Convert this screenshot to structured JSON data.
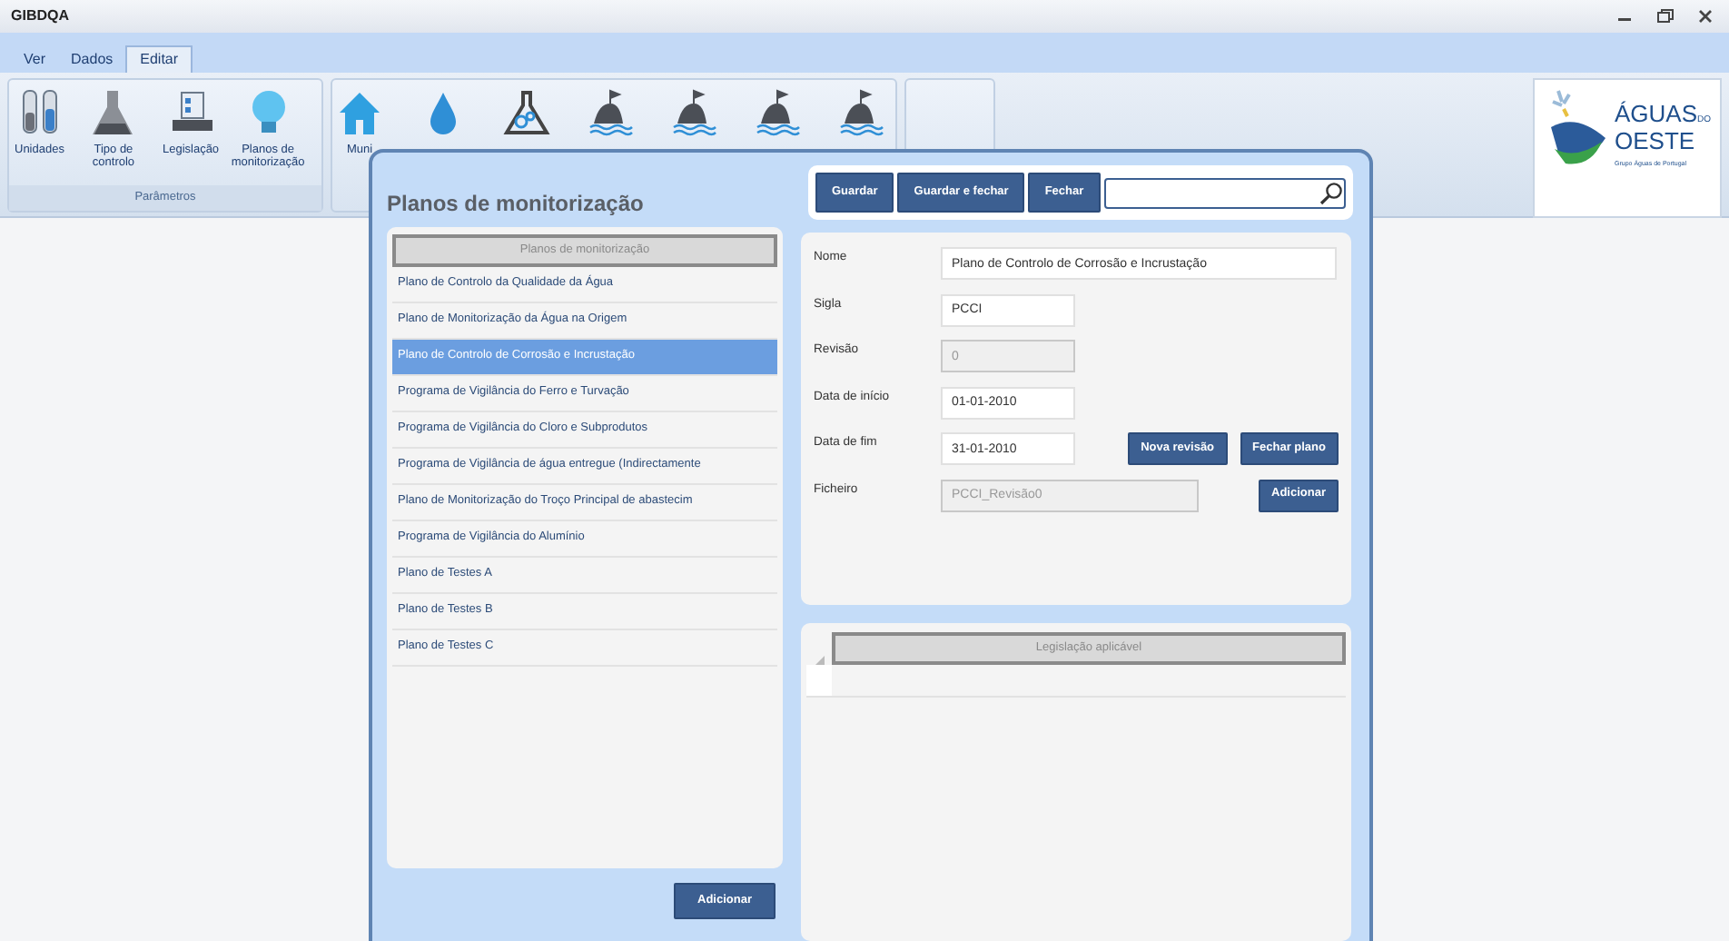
{
  "window": {
    "title": "GIBDQA"
  },
  "menu_tabs": [
    {
      "label": "Ver",
      "selected": false
    },
    {
      "label": "Dados",
      "selected": false
    },
    {
      "label": "Editar",
      "selected": true
    }
  ],
  "ribbon": {
    "groups": [
      {
        "label": "Parâmetros",
        "items": [
          {
            "kind": "test-tubes",
            "label": "Unidades"
          },
          {
            "kind": "flask",
            "label": "Tipo de controlo"
          },
          {
            "kind": "document",
            "label": "Legislação"
          },
          {
            "kind": "lightbulb",
            "label": "Planos de monitorização"
          }
        ]
      },
      {
        "items": [
          {
            "kind": "house",
            "label": "Muni"
          },
          {
            "kind": "drop"
          },
          {
            "kind": "bubble-flask"
          },
          {
            "kind": "island"
          },
          {
            "kind": "island"
          },
          {
            "kind": "island"
          },
          {
            "kind": "island"
          }
        ]
      }
    ]
  },
  "logo": {
    "name": "ÁGUAS",
    "suffix": "DO",
    "name2": "OESTE",
    "tagline": "Grupo Águas de Portugal"
  },
  "dialog": {
    "title": "Planos de monitorização",
    "toolbar_buttons": [
      "Guardar",
      "Guardar e fechar",
      "Fechar"
    ],
    "plans": {
      "header": "Planos de monitorização",
      "add_button": "Adicionar",
      "items": [
        {
          "label": "Plano de Controlo da Qualidade da Água",
          "selected": false
        },
        {
          "label": "Plano de Monitorização da Água na Origem",
          "selected": false
        },
        {
          "label": "Plano de Controlo de Corrosão e Incrustação",
          "selected": true
        },
        {
          "label": "Programa de Vigilância do Ferro e Turvação",
          "selected": false
        },
        {
          "label": "Programa de Vigilância do Cloro e Subprodutos",
          "selected": false
        },
        {
          "label": "Programa de Vigilância de água entregue (Indirectamente",
          "selected": false
        },
        {
          "label": "Plano de Monitorização do Troço Principal de abastecim",
          "selected": false
        },
        {
          "label": "Programa de Vigilância do Alumínio",
          "selected": false
        },
        {
          "label": "Plano de Testes A",
          "selected": false
        },
        {
          "label": "Plano de Testes B",
          "selected": false
        },
        {
          "label": "Plano de Testes C",
          "selected": false
        }
      ]
    },
    "form": {
      "fields": [
        {
          "label": "Nome",
          "value": "Plano de Controlo de Corrosão e Incrustação",
          "disabled": false
        },
        {
          "label": "Sigla",
          "value": "PCCI",
          "disabled": false
        },
        {
          "label": "Revisão",
          "value": "0",
          "disabled": true
        },
        {
          "label": "Data de início",
          "value": "01-01-2010",
          "disabled": false
        },
        {
          "label": "Data de fim",
          "value": "31-01-2010",
          "disabled": false,
          "buttons": [
            "Nova revisão",
            "Fechar plano"
          ]
        },
        {
          "label": "Ficheiro",
          "value": "PCCI_Revisão0",
          "disabled": true,
          "buttons": [
            "Adicionar"
          ]
        }
      ]
    },
    "legislation": {
      "columns": [
        "Legislação aplicável"
      ]
    }
  }
}
